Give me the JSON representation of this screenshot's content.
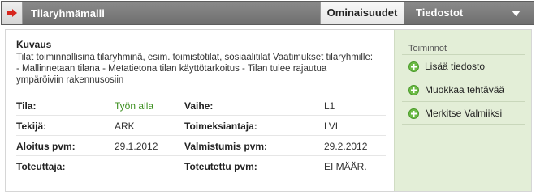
{
  "header": {
    "title": "Tilaryhmämalli",
    "tabs": [
      {
        "label": "Ominaisuudet",
        "active": true
      },
      {
        "label": "Tiedostot",
        "active": false
      }
    ],
    "icons": {
      "arrow": "arrow-right-icon",
      "dropdown": "chevron-down-icon"
    },
    "arrow_color": "#d7261e"
  },
  "description": {
    "title": "Kuvaus",
    "text": "Tilat toiminnallisina tilaryhminä, esim. toimistotilat, sosiaalitilat Vaatimukset tilaryhmille: - Mallinnetaan tilana - Metatietona tilan käyttötarkoitus - Tilan tulee rajautua ympäröiviin rakennusosiin"
  },
  "properties": [
    {
      "label1": "Tila:",
      "value1": "Työn alla",
      "label2": "Vaihe:",
      "value2": "L1"
    },
    {
      "label1": "Tekijä:",
      "value1": "ARK",
      "label2": "Toimeksiantaja:",
      "value2": "LVI"
    },
    {
      "label1": "Aloitus pvm:",
      "value1": "29.1.2012",
      "label2": "Valmistumis pvm:",
      "value2": "29.2.2012"
    },
    {
      "label1": "Toteuttaja:",
      "value1": "",
      "label2": "Toteutettu pvm:",
      "value2": "EI MÄÄR."
    }
  ],
  "sidebar": {
    "title": "Toiminnot",
    "actions": [
      {
        "label": "Lisää tiedosto",
        "icon": "plus-circle-icon"
      },
      {
        "label": "Muokkaa tehtävää",
        "icon": "plus-circle-icon"
      },
      {
        "label": "Merkitse Valmiiksi",
        "icon": "plus-circle-icon"
      }
    ]
  },
  "colors": {
    "status_green": "#3c8f1f",
    "sidebar_bg": "#e3eed7",
    "header_bg": "#7d7d7d"
  }
}
